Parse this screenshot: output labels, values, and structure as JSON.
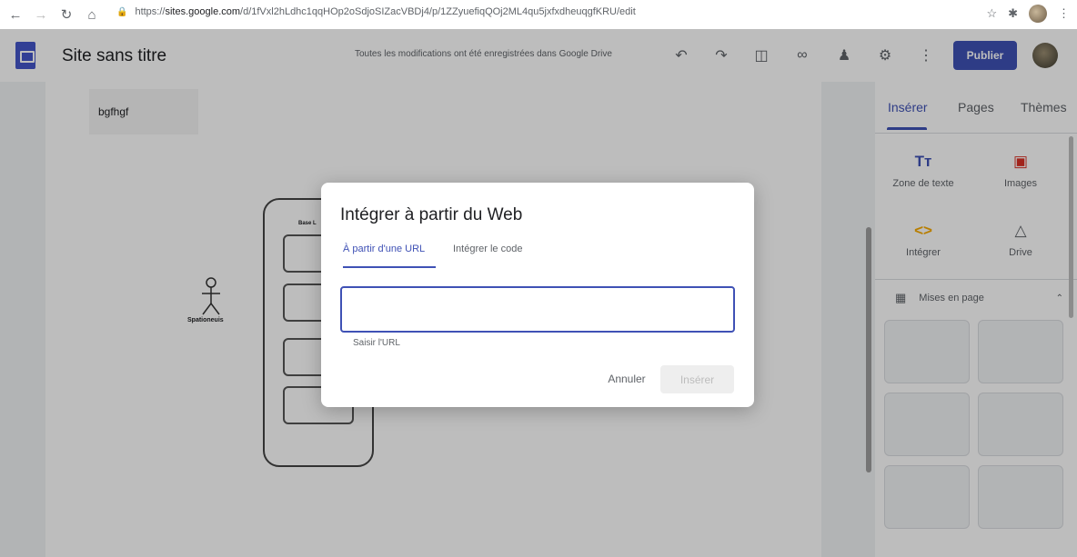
{
  "browser": {
    "url_prefix": "https://",
    "url_host": "sites.google.com",
    "url_path": "/d/1fVxl2hLdhc1qqHOp2oSdjoSIZacVBDj4/p/1ZZyuefiqQOj2ML4qu5jxfxdheuqgfKRU/edit",
    "icons": [
      "back-arrow-icon",
      "forward-arrow-icon",
      "reload-icon",
      "home-icon",
      "lock-icon",
      "star-icon",
      "extension-icon",
      "profile-icon",
      "menu-icon"
    ]
  },
  "header": {
    "site_title": "Site sans titre",
    "save_status": "Toutes les modifications ont été enregistrées dans Google Drive",
    "publish_label": "Publier",
    "brand_color": "#3f51b5"
  },
  "canvas": {
    "text_block": "bgfhgf",
    "actor_label": "Spationeuis",
    "phone_title": "Base L"
  },
  "side_panel": {
    "tabs": [
      "Insérer",
      "Pages",
      "Thèmes"
    ],
    "tools": [
      "Zone de texte",
      "Images",
      "Intégrer",
      "Drive"
    ],
    "layouts_label": "Mises en page"
  },
  "dialog": {
    "title": "Intégrer à partir du Web",
    "tabs": [
      "À partir d'une URL",
      "Intégrer le code"
    ],
    "input_value": "",
    "hint": "Saisir l'URL",
    "cancel_label": "Annuler",
    "insert_label": "Insérer"
  }
}
